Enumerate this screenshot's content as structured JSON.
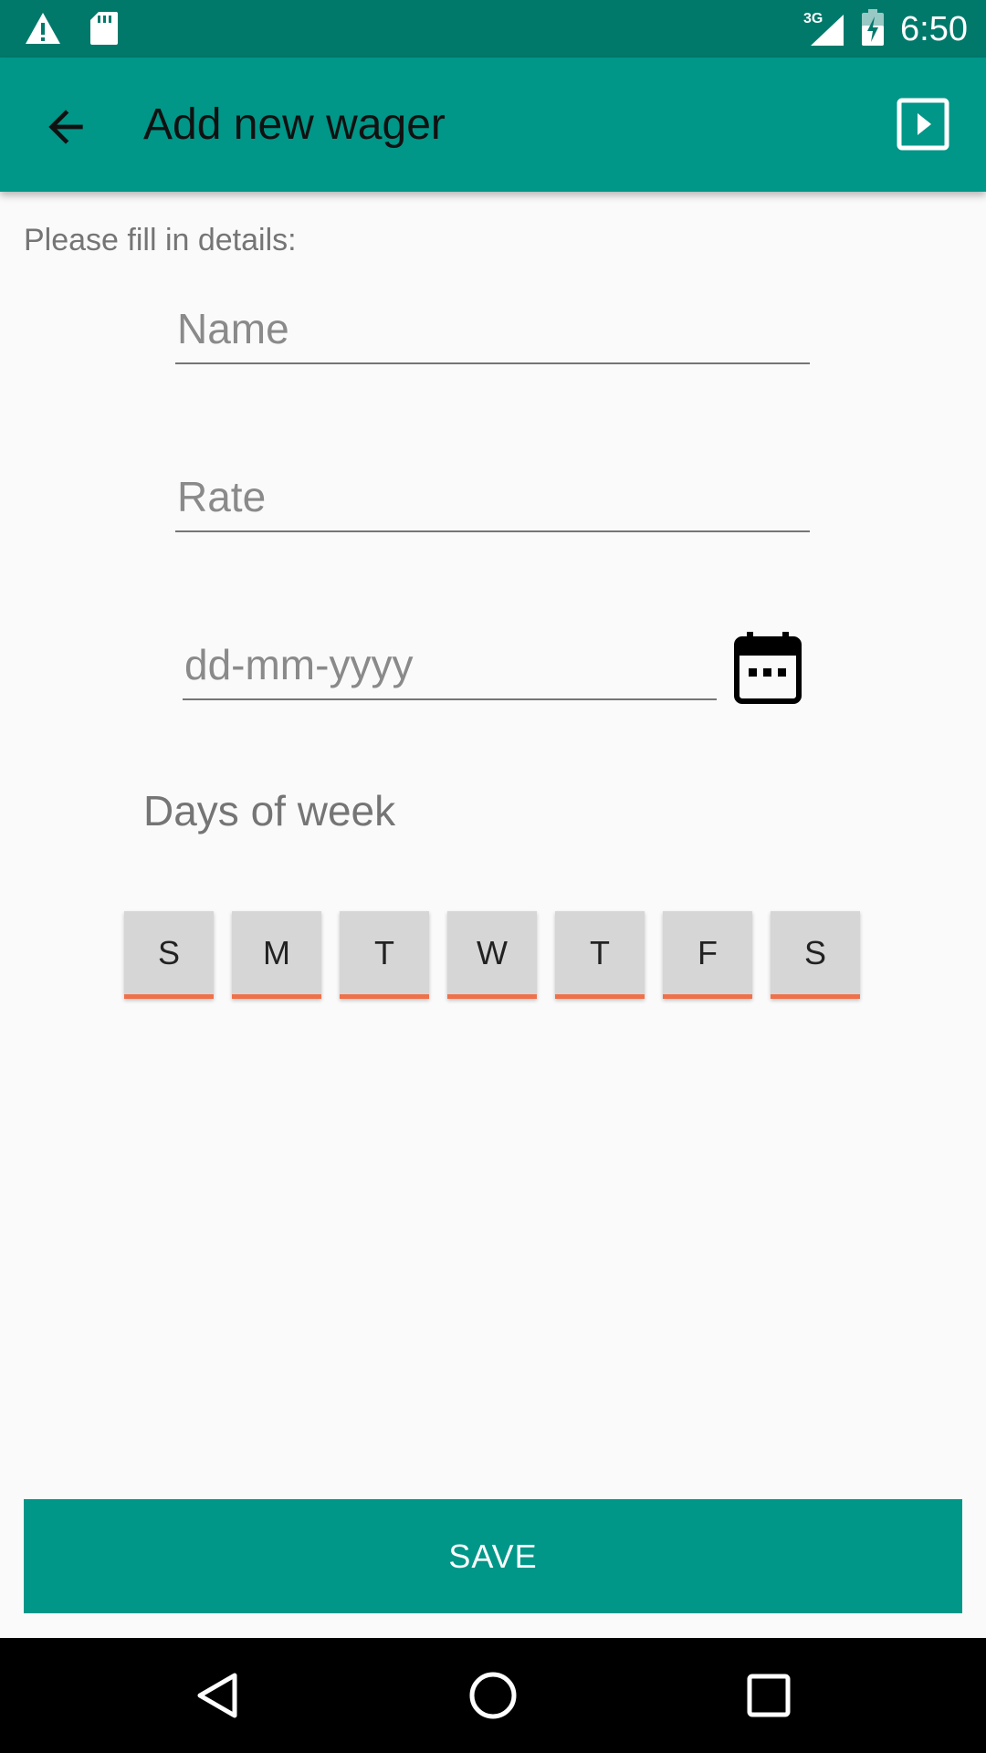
{
  "status_bar": {
    "time": "6:50",
    "network": "3G",
    "icons": [
      "alert-icon",
      "sd-card-icon",
      "signal-icon",
      "battery-icon"
    ]
  },
  "app_bar": {
    "title": "Add new wager",
    "back_icon": "arrow-back-icon",
    "action_icon": "play-box-icon"
  },
  "form": {
    "instructions": "Please fill in details:",
    "name_placeholder": "Name",
    "rate_placeholder": "Rate",
    "date_placeholder": "dd-mm-yyyy",
    "days_label": "Days of week",
    "days": [
      "S",
      "M",
      "T",
      "W",
      "T",
      "F",
      "S"
    ]
  },
  "save_label": "SAVE",
  "colors": {
    "primary": "#009688",
    "primary_dark": "#00796b",
    "accent_underline": "#f0704a"
  }
}
